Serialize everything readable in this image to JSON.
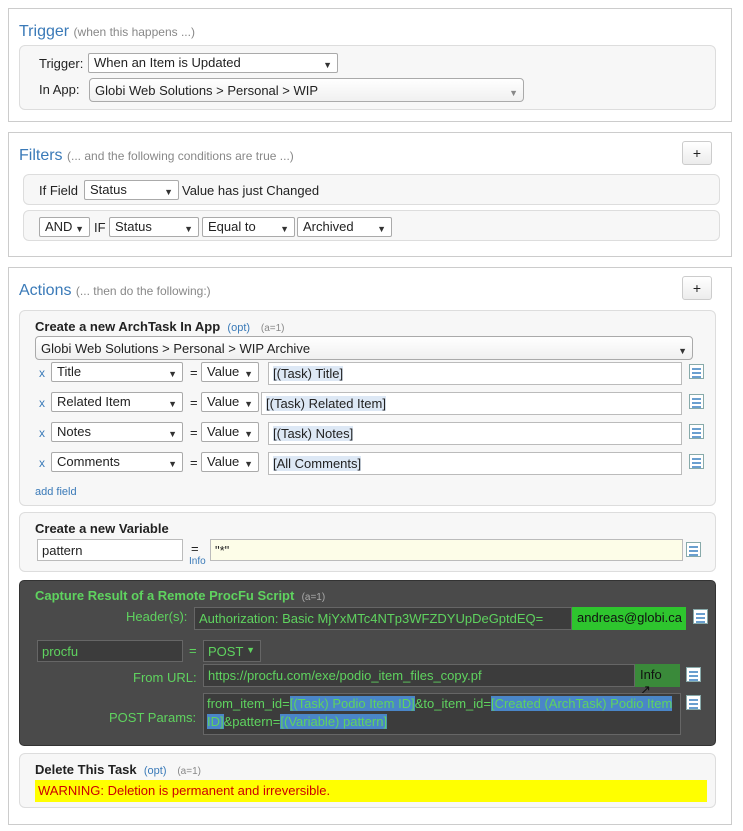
{
  "trigger": {
    "title": "Trigger",
    "subtitle": "(when this happens ...)",
    "trigger_label": "Trigger:",
    "trigger_value": "When an Item is Updated",
    "app_label": "In App:",
    "app_value": "Globi Web Solutions > Personal > WIP"
  },
  "filters": {
    "title": "Filters",
    "subtitle": "(... and the following conditions are true ...)",
    "add": "+",
    "row1": {
      "if_label": "If Field",
      "field": "Status",
      "text": "Value has just Changed"
    },
    "row2": {
      "and": "AND",
      "if": "IF",
      "field": "Status",
      "op": "Equal to",
      "value": "Archived"
    }
  },
  "actions": {
    "title": "Actions",
    "subtitle": "(... then do the following:)",
    "add": "+",
    "archtask": {
      "title": "Create a new ArchTask In App",
      "opt": "(opt)",
      "tag": "(a=1)",
      "app": "Globi Web Solutions > Personal > WIP Archive",
      "rows": [
        {
          "x": "x",
          "field": "Title",
          "eq": "=",
          "type": "Value",
          "val": "[(Task) Title]"
        },
        {
          "x": "x",
          "field": "Related Item",
          "eq": "=",
          "type": "Value",
          "val": "[(Task) Related Item]"
        },
        {
          "x": "x",
          "field": "Notes",
          "eq": "=",
          "type": "Value",
          "val": "[(Task) Notes]"
        },
        {
          "x": "x",
          "field": "Comments",
          "eq": "=",
          "type": "Value",
          "val": "[All Comments]"
        }
      ],
      "add_field": "add field"
    },
    "variable": {
      "title": "Create a new Variable",
      "name": "pattern",
      "eq": "=",
      "info": "Info",
      "value": "\"*\""
    },
    "procfu": {
      "title": "Capture Result of a Remote ProcFu Script",
      "tag": "(a=1)",
      "headers_label": "Header(s):",
      "headers_value": "Authorization: Basic MjYxMTc4NTp3WFZDYUpDeGptdEQ=",
      "headers_user": "andreas@globi.ca",
      "var_name": "procfu",
      "eq": "=",
      "method": "POST",
      "url_label": "From URL:",
      "url": "https://procfu.com/exe/podio_item_files_copy.pf",
      "info": "Info ↗",
      "params_label": "POST Params:",
      "params": {
        "p1": "from_item_id=",
        "t1": "[(Task) Podio Item ID]",
        "p2": "&to_item_id=",
        "t2a": "[Created (ArchTask) Podio Item",
        "t2b": "ID]",
        "p3": "&pattern=",
        "t3": "[(Variable) pattern]"
      }
    },
    "delete": {
      "title": "Delete This Task",
      "opt": "(opt)",
      "tag": "(a=1)",
      "warning": "WARNING: Deletion is permanent and irreversible."
    }
  }
}
